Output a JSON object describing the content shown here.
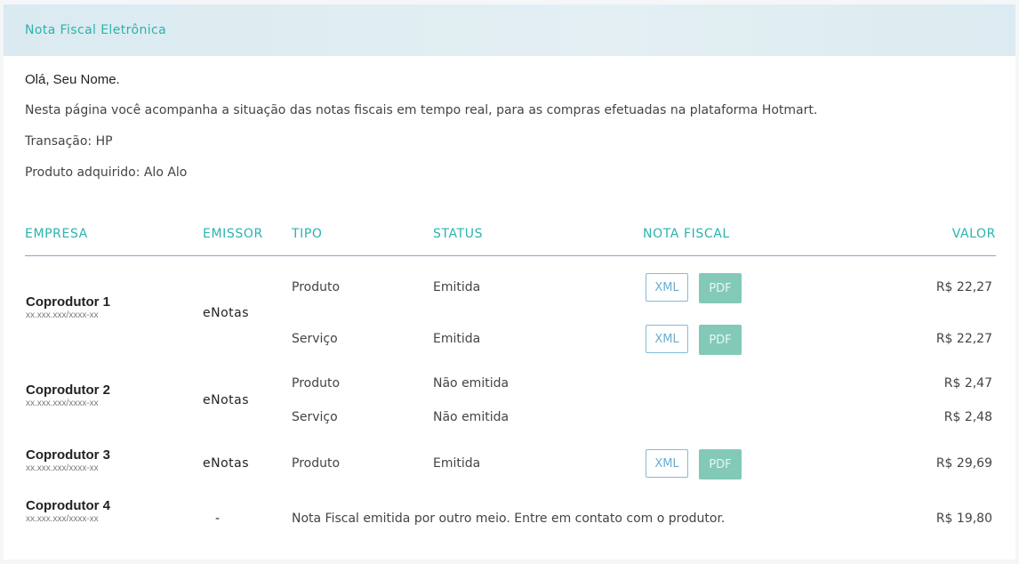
{
  "header": {
    "title": "Nota Fiscal Eletrônica"
  },
  "intro": {
    "greeting": "Olá, Seu Nome.",
    "description": "Nesta página você acompanha a situação das notas fiscais em tempo real, para as compras efetuadas na plataforma Hotmart.",
    "transaction": "Transação: HP",
    "product": "Produto adquirido: Alo Alo"
  },
  "table": {
    "headers": {
      "empresa": "EMPRESA",
      "emissor": "EMISSOR",
      "tipo": "TIPO",
      "status": "STATUS",
      "nota_fiscal": "NOTA FISCAL",
      "valor": "VALOR"
    },
    "xml_label": "XML",
    "pdf_label": "PDF",
    "companies": [
      {
        "name": "Coprodutor 1",
        "doc": "xx.xxx.xxx/xxxx-xx",
        "emissor": "eNotas",
        "rows": [
          {
            "tipo": "Produto",
            "status": "Emitida",
            "valor": "R$ 22,27",
            "has_files": true
          },
          {
            "tipo": "Serviço",
            "status": "Emitida",
            "valor": "R$ 22,27",
            "has_files": true
          }
        ]
      },
      {
        "name": "Coprodutor 2",
        "doc": "xx.xxx.xxx/xxxx-xx",
        "emissor": "eNotas",
        "rows": [
          {
            "tipo": "Produto",
            "status": "Não emitida",
            "valor": "R$ 2,47",
            "has_files": false
          },
          {
            "tipo": "Serviço",
            "status": "Não emitida",
            "valor": "R$ 2,48",
            "has_files": false
          }
        ]
      },
      {
        "name": "Coprodutor 3",
        "doc": "xx.xxx.xxx/xxxx-xx",
        "emissor": "eNotas",
        "rows": [
          {
            "tipo": "Produto",
            "status": "Emitida",
            "valor": "R$ 29,69",
            "has_files": true
          }
        ]
      },
      {
        "name": "Coprodutor 4",
        "doc": "xx.xxx.xxx/xxxx-xx",
        "emissor": "-",
        "message": "Nota Fiscal emitida por outro meio. Entre em contato com o produtor.",
        "valor": "R$ 19,80"
      }
    ]
  }
}
